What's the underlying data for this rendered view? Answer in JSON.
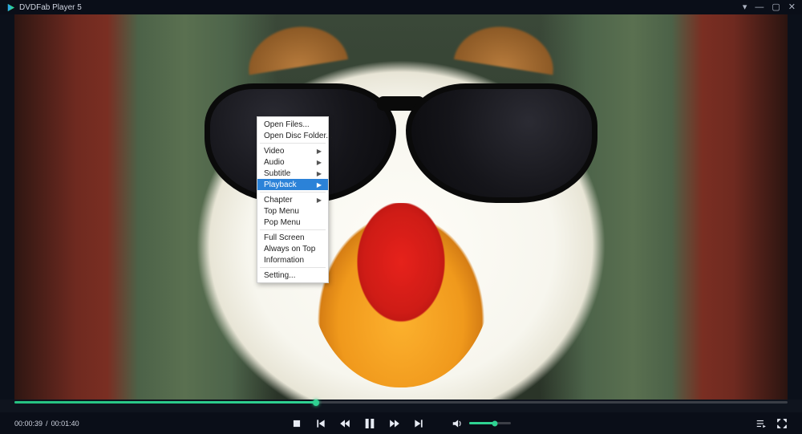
{
  "titlebar": {
    "app_title": "DVDFab Player 5"
  },
  "context_menu": {
    "items": [
      {
        "label": "Open Files...",
        "submenu": false
      },
      {
        "label": "Open Disc Folder...",
        "submenu": false
      },
      {
        "sep": true
      },
      {
        "label": "Video",
        "submenu": true
      },
      {
        "label": "Audio",
        "submenu": true
      },
      {
        "label": "Subtitle",
        "submenu": true
      },
      {
        "label": "Playback",
        "submenu": true,
        "active": true
      },
      {
        "sep": true
      },
      {
        "label": "Chapter",
        "submenu": true
      },
      {
        "label": "Top Menu",
        "submenu": false
      },
      {
        "label": "Pop Menu",
        "submenu": false
      },
      {
        "sep": true
      },
      {
        "label": "Full Screen",
        "submenu": false
      },
      {
        "label": "Always on Top",
        "submenu": false
      },
      {
        "label": "Information",
        "submenu": false
      },
      {
        "sep": true
      },
      {
        "label": "Setting...",
        "submenu": false
      }
    ]
  },
  "playback": {
    "current_time": "00:00:39",
    "total_time": "00:01:40",
    "separator": "/",
    "progress_percent": 39,
    "volume_percent": 62
  },
  "icons": {
    "dropdown": "▾",
    "minimize": "—",
    "maximize": "▢",
    "close": "✕",
    "submenu_arrow": "▶"
  }
}
